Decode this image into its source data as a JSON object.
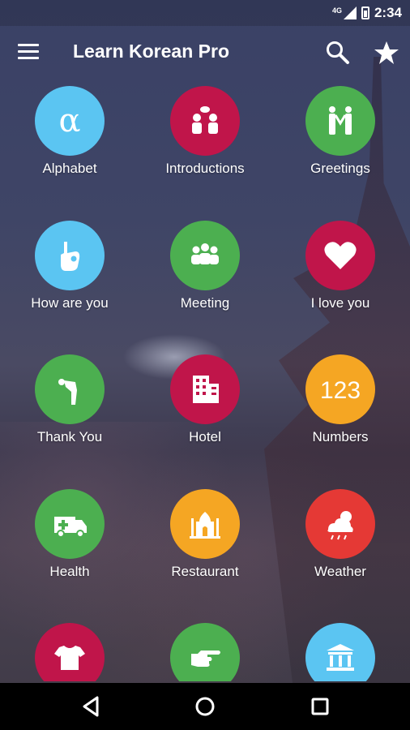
{
  "status_bar": {
    "time": "2:34",
    "network": "4G"
  },
  "app_bar": {
    "title": "Learn Korean Pro"
  },
  "colors": {
    "blue": "#5BC5F2",
    "crimson": "#C0154A",
    "green": "#4CAF50",
    "orange": "#F5A623",
    "red": "#E53935"
  },
  "categories": [
    {
      "label": "Alphabet",
      "icon": "alpha-icon",
      "color": "#5BC5F2"
    },
    {
      "label": "Introductions",
      "icon": "people-talking-icon",
      "color": "#C0154A"
    },
    {
      "label": "Greetings",
      "icon": "handshake-icon",
      "color": "#4CAF50"
    },
    {
      "label": "How are you",
      "icon": "ok-hand-icon",
      "color": "#5BC5F2"
    },
    {
      "label": "Meeting",
      "icon": "group-icon",
      "color": "#4CAF50"
    },
    {
      "label": "I love you",
      "icon": "heart-icon",
      "color": "#C0154A"
    },
    {
      "label": "Thank You",
      "icon": "bowing-person-icon",
      "color": "#4CAF50"
    },
    {
      "label": "Hotel",
      "icon": "building-icon",
      "color": "#C0154A"
    },
    {
      "label": "Numbers",
      "icon": "numbers-icon",
      "color": "#F5A623",
      "glyph": "123"
    },
    {
      "label": "Health",
      "icon": "ambulance-icon",
      "color": "#4CAF50"
    },
    {
      "label": "Restaurant",
      "icon": "palace-icon",
      "color": "#F5A623"
    },
    {
      "label": "Weather",
      "icon": "weather-icon",
      "color": "#E53935"
    },
    {
      "label": "",
      "icon": "tshirt-icon",
      "color": "#C0154A"
    },
    {
      "label": "",
      "icon": "pointing-hand-icon",
      "color": "#4CAF50"
    },
    {
      "label": "",
      "icon": "bank-icon",
      "color": "#5BC5F2"
    }
  ]
}
